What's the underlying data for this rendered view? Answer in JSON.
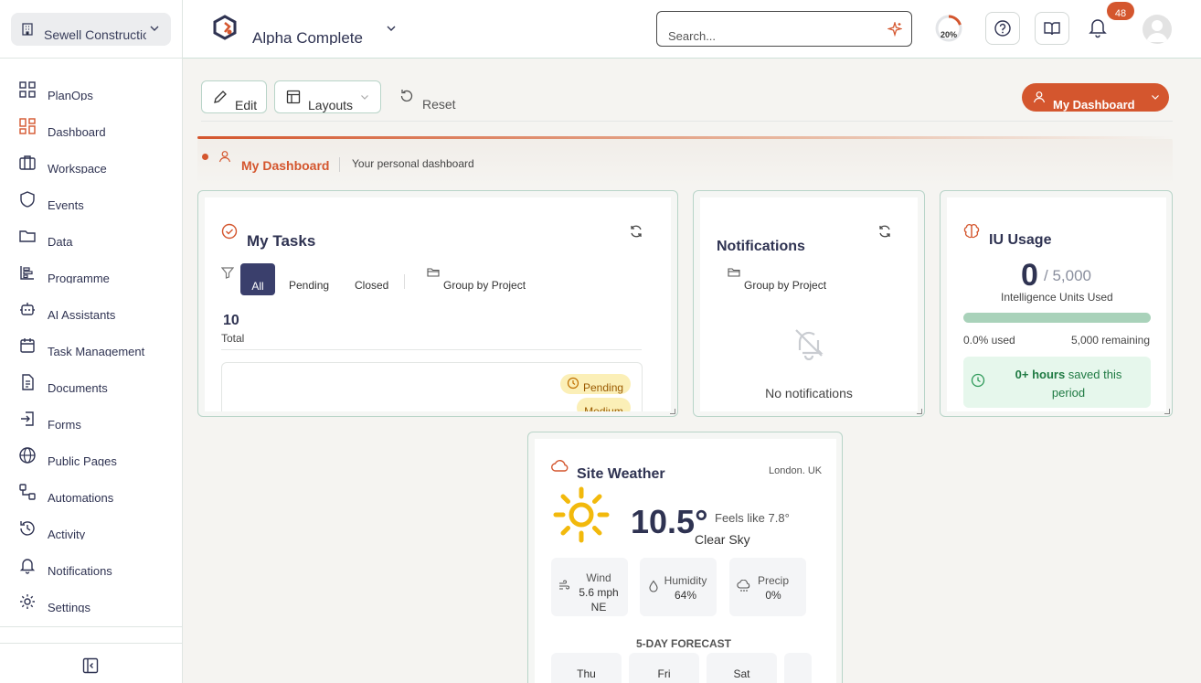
{
  "sidebar": {
    "org_name": "Sewell Construction",
    "items": [
      {
        "label": "PlanOps",
        "icon": "grid-icon"
      },
      {
        "label": "Dashboard",
        "icon": "dashboard-icon"
      },
      {
        "label": "Workspace",
        "icon": "briefcase-icon"
      },
      {
        "label": "Events",
        "icon": "shield-icon"
      },
      {
        "label": "Data",
        "icon": "folder-icon"
      },
      {
        "label": "Programme",
        "icon": "gantt-icon"
      },
      {
        "label": "AI Assistants",
        "icon": "robot-icon"
      },
      {
        "label": "Task Management",
        "icon": "calendar-icon"
      },
      {
        "label": "Documents",
        "icon": "document-icon"
      },
      {
        "label": "Forms",
        "icon": "form-login-icon"
      },
      {
        "label": "Public Pages",
        "icon": "globe-icon"
      },
      {
        "label": "Automations",
        "icon": "workflow-icon"
      },
      {
        "label": "Activity",
        "icon": "history-icon"
      },
      {
        "label": "Notifications",
        "icon": "bell-icon"
      },
      {
        "label": "Settings",
        "icon": "gear-icon"
      }
    ],
    "active_item": "Dashboard"
  },
  "header": {
    "app_name": "Alpha Complete",
    "search_placeholder": "Search...",
    "progress_label": "20%",
    "progress_value": 0.2,
    "notification_count": "48"
  },
  "toolbar": {
    "edit_label": "Edit",
    "layouts_label": "Layouts",
    "reset_label": "Reset",
    "dashboard_select_label": "My Dashboard"
  },
  "banner": {
    "title": "My Dashboard",
    "subtitle": "Your personal dashboard"
  },
  "tasks": {
    "title": "My Tasks",
    "filters": [
      "All",
      "Pending",
      "Closed"
    ],
    "active_filter": "All",
    "group_by_label": "Group by Project",
    "count": "10",
    "count_label": "Total",
    "card_status": "Pending",
    "card_priority": "Medium"
  },
  "notifications": {
    "title": "Notifications",
    "group_by_label": "Group by Project",
    "empty_text": "No notifications"
  },
  "iu_usage": {
    "title": "IU Usage",
    "used_value": "0",
    "limit_text": "/ 5,000",
    "units_label": "Intelligence Units Used",
    "used_pct_text": "0.0% used",
    "remaining_text": "5,000 remaining",
    "used_fraction": 0.0,
    "saved_bold": "0+ hours",
    "saved_rest": " saved this period"
  },
  "weather": {
    "title": "Site Weather",
    "location": "London, UK",
    "temperature": "10.5°",
    "feels_like": "Feels like 7.8°",
    "condition": "Clear Sky",
    "wind_label": "Wind",
    "wind_speed": "5.6 mph",
    "wind_dir": "NE",
    "humidity_label": "Humidity",
    "humidity_value": "64%",
    "precip_label": "Precip",
    "precip_value": "0%",
    "forecast_title": "5-DAY FORECAST",
    "forecast_days": [
      "Thu",
      "Fri",
      "Sat"
    ]
  },
  "colors": {
    "accent": "#d4562e",
    "navy": "#2f3352",
    "border": "#b8d4c8"
  }
}
